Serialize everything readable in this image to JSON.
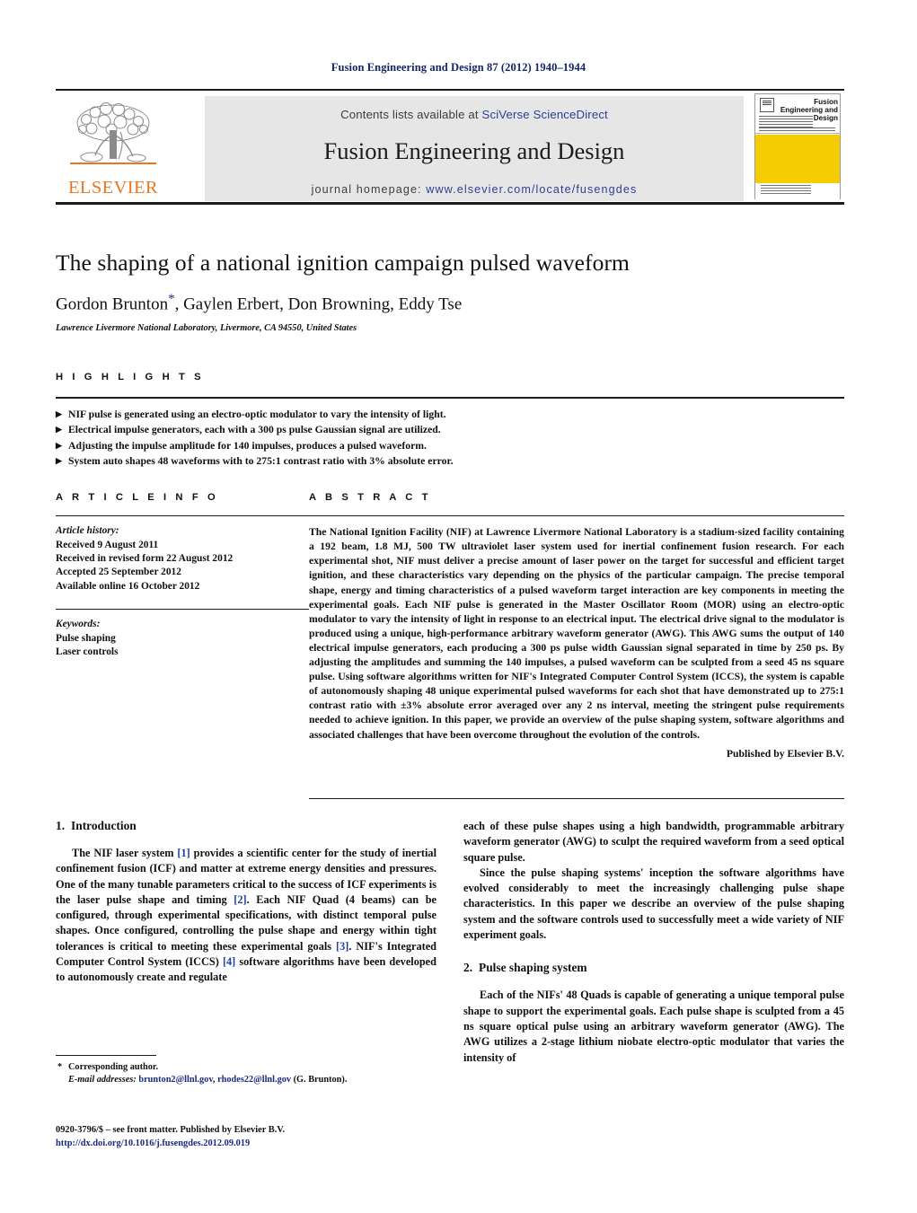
{
  "running_head": "Fusion Engineering and Design 87 (2012) 1940–1944",
  "masthead": {
    "contents_prefix": "Contents lists available at ",
    "contents_link": "SciVerse ScienceDirect",
    "journal_title": "Fusion Engineering and Design",
    "homepage_prefix": "journal homepage: ",
    "homepage_url": "www.elsevier.com/locate/fusengdes",
    "publisher_wordmark": "ELSEVIER",
    "cover_title": "Fusion Engineering and Design",
    "accent_yellow": "#f5cc00",
    "link_color": "#2c3f96"
  },
  "title": "The shaping of a national ignition campaign pulsed waveform",
  "authors": "Gordon Brunton*, Gaylen Erbert, Don Browning, Eddy Tse",
  "authors_parts": {
    "first": "Gordon Brunton",
    "star": "*",
    "rest": ", Gaylen Erbert, Don Browning, Eddy Tse"
  },
  "affiliation": "Lawrence Livermore National Laboratory, Livermore, CA 94550, United States",
  "highlights": {
    "heading": "H I G H L I G H T S",
    "items": [
      "NIF pulse is generated using an electro-optic modulator to vary the intensity of light.",
      "Electrical impulse generators, each with a 300 ps pulse Gaussian signal are utilized.",
      "Adjusting the impulse amplitude for 140 impulses, produces a pulsed waveform.",
      "System auto shapes 48 waveforms with to 275:1 contrast ratio with 3% absolute error.",
      "▶"
    ],
    "bullet": "▶"
  },
  "article_info": {
    "heading": "A R T I C L E   I N F O",
    "history_label": "Article history:",
    "history": [
      "Received 9 August 2011",
      "Received in revised form 22 August 2012",
      "Accepted 25 September 2012",
      "Available online 16 October 2012"
    ],
    "keywords_label": "Keywords:",
    "keywords": [
      "Pulse shaping",
      "Laser controls"
    ]
  },
  "abstract": {
    "heading": "A B S T R A C T",
    "text": "The National Ignition Facility (NIF) at Lawrence Livermore National Laboratory is a stadium-sized facility containing a 192 beam, 1.8 MJ, 500 TW ultraviolet laser system used for inertial confinement fusion research. For each experimental shot, NIF must deliver a precise amount of laser power on the target for successful and efficient target ignition, and these characteristics vary depending on the physics of the particular campaign. The precise temporal shape, energy and timing characteristics of a pulsed waveform target interaction are key components in meeting the experimental goals. Each NIF pulse is generated in the Master Oscillator Room (MOR) using an electro-optic modulator to vary the intensity of light in response to an electrical input. The electrical drive signal to the modulator is produced using a unique, high-performance arbitrary waveform generator (AWG). This AWG sums the output of 140 electrical impulse generators, each producing a 300 ps pulse width Gaussian signal separated in time by 250 ps. By adjusting the amplitudes and summing the 140 impulses, a pulsed waveform can be sculpted from a seed 45 ns square pulse. Using software algorithms written for NIF's Integrated Computer Control System (ICCS), the system is capable of autonomously shaping 48 unique experimental pulsed waveforms for each shot that have demonstrated up to 275:1 contrast ratio with ±3% absolute error averaged over any 2 ns interval, meeting the stringent pulse requirements needed to achieve ignition. In this paper, we provide an overview of the pulse shaping system, software algorithms and associated challenges that have been overcome throughout the evolution of the controls.",
    "published_by": "Published by Elsevier B.V."
  },
  "body": {
    "left": {
      "section_number": "1.",
      "section_title": "Introduction",
      "paragraph_1_a": "The NIF laser system ",
      "ref1": "[1]",
      "paragraph_1_b": " provides a scientific center for the study of inertial confinement fusion (ICF) and matter at extreme energy densities and pressures. One of the many tunable parameters critical to the success of ICF experiments is the laser pulse shape and timing ",
      "ref2": "[2]",
      "paragraph_1_c": ". Each NIF Quad (4 beams) can be configured, through experimental specifications, with distinct temporal pulse shapes. Once configured, controlling the pulse shape and energy within tight tolerances is critical to meeting these experimental goals ",
      "ref3": "[3]",
      "paragraph_1_d": ". NIF's Integrated Computer Control System (ICCS) ",
      "ref4": "[4]",
      "paragraph_1_e": " software algorithms have been developed to autonomously create and regulate"
    },
    "right": {
      "paragraph_cont": "each of these pulse shapes using a high bandwidth, programmable arbitrary waveform generator (AWG) to sculpt the required waveform from a seed optical square pulse.",
      "paragraph_2": "Since the pulse shaping systems' inception the software algorithms have evolved considerably to meet the increasingly challenging pulse shape characteristics. In this paper we describe an overview of the pulse shaping system and the software controls used to successfully meet a wide variety of NIF experiment goals.",
      "section_number": "2.",
      "section_title": "Pulse shaping system",
      "paragraph_3": "Each of the NIFs' 48 Quads is capable of generating a unique temporal pulse shape to support the experimental goals. Each pulse shape is sculpted from a 45 ns square optical pulse using an arbitrary waveform generator (AWG). The AWG utilizes a 2-stage lithium niobate electro-optic modulator that varies the intensity of"
    }
  },
  "footnote": {
    "asterisk": "*",
    "corresponding": "Corresponding author.",
    "email_label": "E-mail addresses:",
    "email_1": "brunton2@llnl.gov",
    "email_sep": ", ",
    "email_2": "rhodes22@llnl.gov",
    "email_suffix": " (G. Brunton)."
  },
  "imprint": {
    "line_1": "0920-3796/$ – see front matter. Published by Elsevier B.V.",
    "doi": "http://dx.doi.org/10.1016/j.fusengdes.2012.09.019"
  }
}
